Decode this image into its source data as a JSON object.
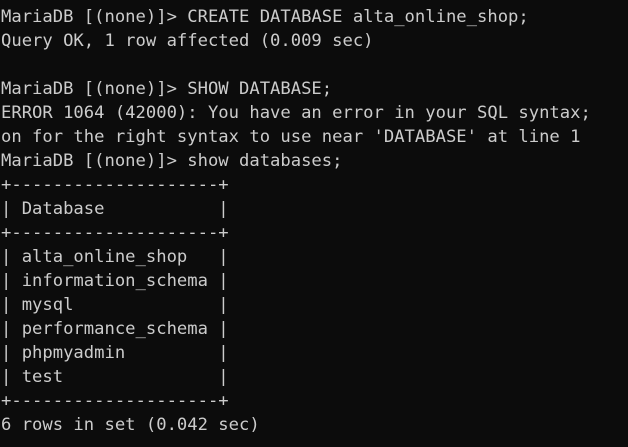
{
  "terminal": {
    "background": "#0c0c0c",
    "foreground": "#cccccc",
    "lines": [
      "MariaDB [(none)]> CREATE DATABASE alta_online_shop;",
      "Query OK, 1 row affected (0.009 sec)",
      "",
      "MariaDB [(none)]> SHOW DATABASE;",
      "ERROR 1064 (42000): You have an error in your SQL syntax;",
      "on for the right syntax to use near 'DATABASE' at line 1",
      "MariaDB [(none)]> show databases;",
      "+--------------------+",
      "| Database           |",
      "+--------------------+",
      "| alta_online_shop   |",
      "| information_schema |",
      "| mysql              |",
      "| performance_schema |",
      "| phpmyadmin         |",
      "| test               |",
      "+--------------------+",
      "6 rows in set (0.042 sec)"
    ]
  }
}
